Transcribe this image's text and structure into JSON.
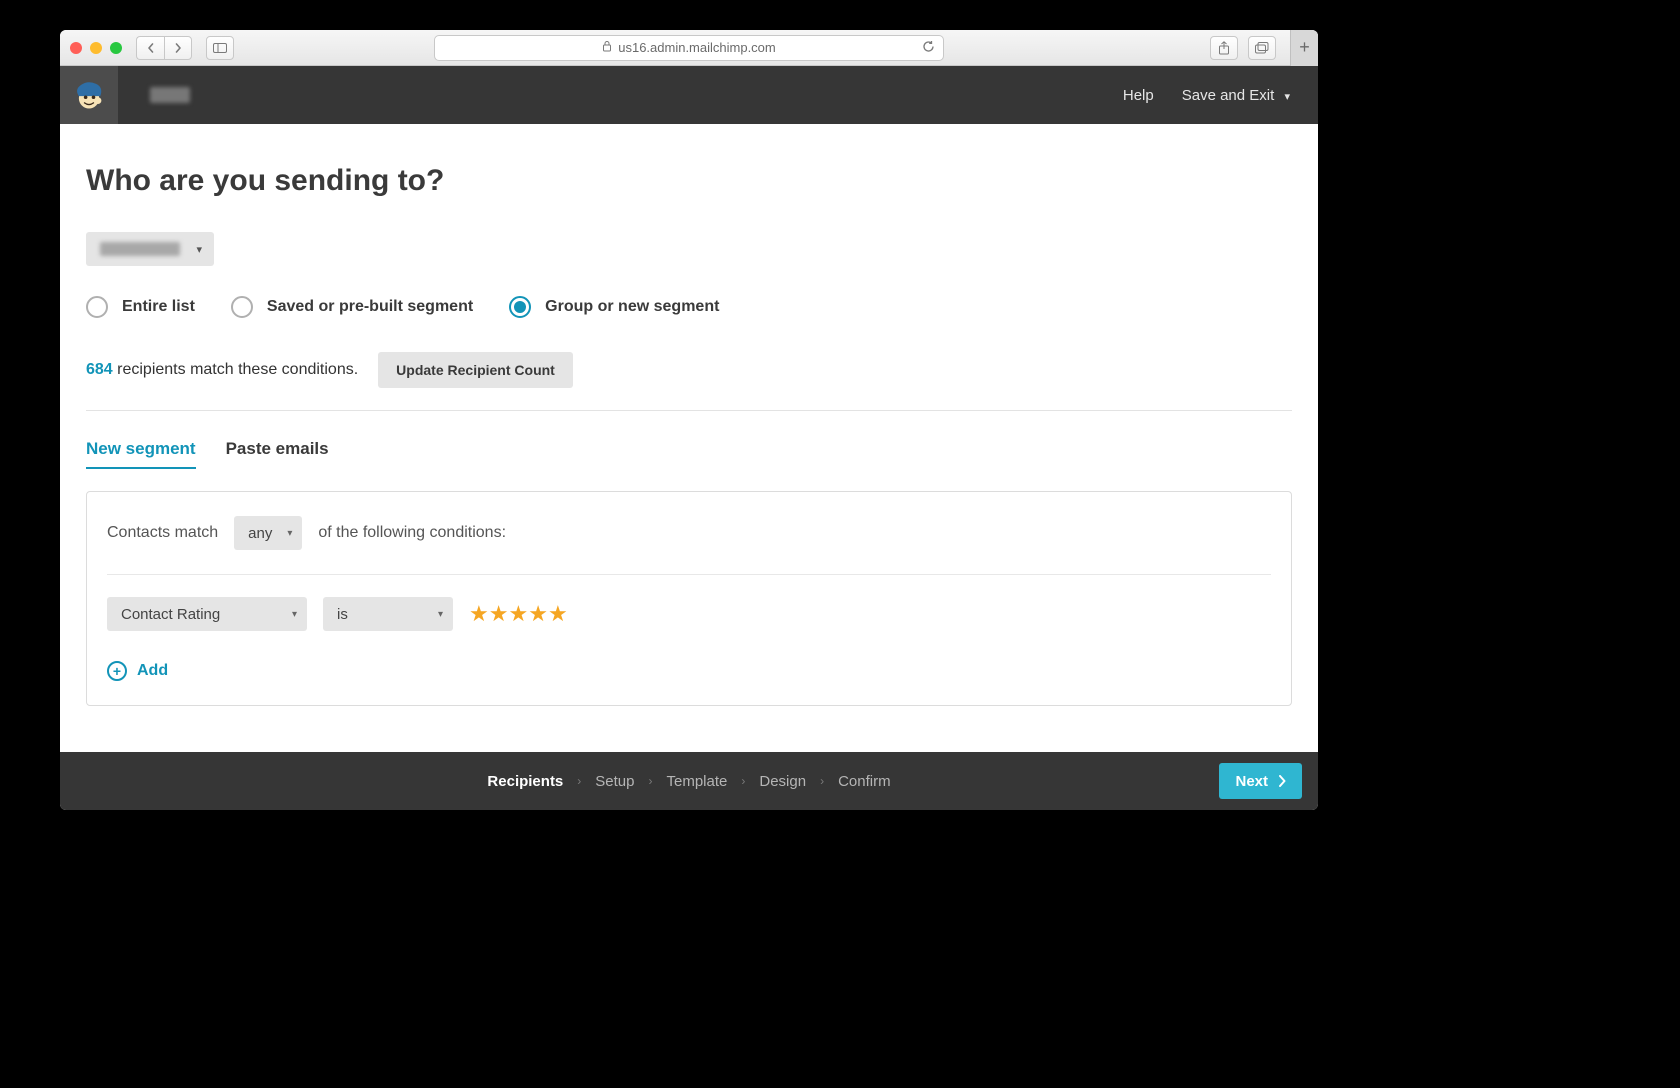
{
  "browser": {
    "url": "us16.admin.mailchimp.com"
  },
  "header": {
    "help": "Help",
    "saveExit": "Save and Exit"
  },
  "page": {
    "title": "Who are you sending to?"
  },
  "radios": {
    "entire": "Entire list",
    "saved": "Saved or pre-built segment",
    "group": "Group or new segment",
    "selected": "group"
  },
  "recipients": {
    "count": "684",
    "suffix": " recipients match these conditions.",
    "updateBtn": "Update Recipient Count"
  },
  "tabs": {
    "newSegment": "New segment",
    "pasteEmails": "Paste emails",
    "active": "newSegment"
  },
  "segment": {
    "matchPrefix": "Contacts match",
    "matchSelect": "any",
    "matchSuffix": "of the following conditions:",
    "condition": {
      "field": "Contact Rating",
      "operator": "is",
      "stars": 5
    },
    "addLabel": "Add"
  },
  "footer": {
    "steps": [
      "Recipients",
      "Setup",
      "Template",
      "Design",
      "Confirm"
    ],
    "activeIndex": 0,
    "next": "Next"
  }
}
